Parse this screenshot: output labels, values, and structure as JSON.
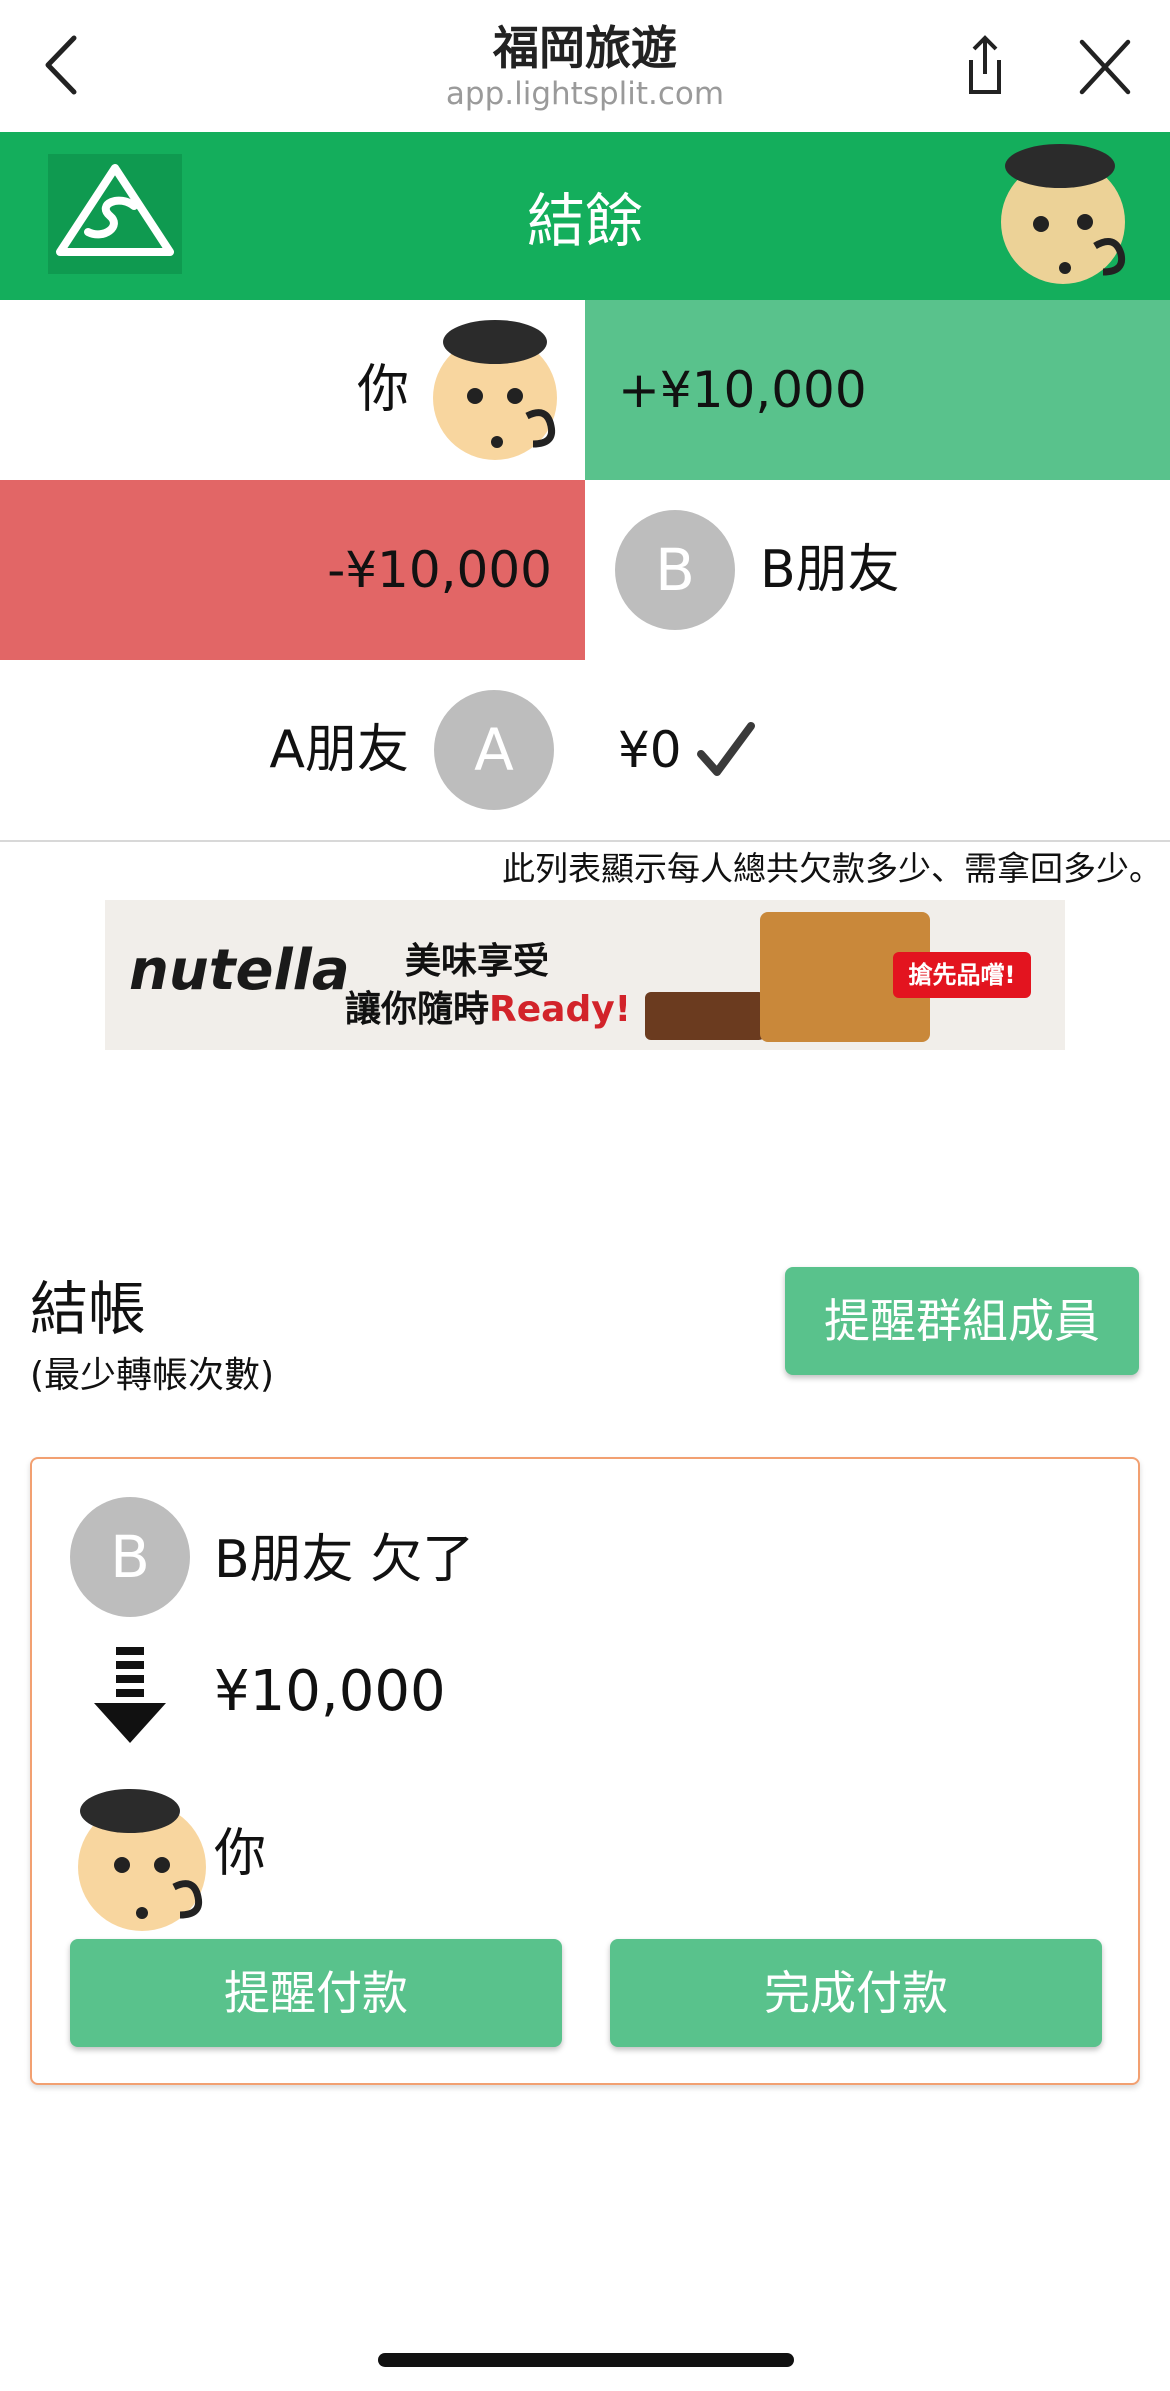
{
  "browser": {
    "title": "福岡旅遊",
    "url": "app.lightsplit.com"
  },
  "header": {
    "title": "結餘"
  },
  "balances": [
    {
      "name": "你",
      "amount": "+¥10,000",
      "status": "positive"
    },
    {
      "name": "B朋友",
      "initial": "B",
      "amount": "-¥10,000",
      "status": "negative"
    },
    {
      "name": "A朋友",
      "initial": "A",
      "amount": "¥0",
      "status": "settled"
    }
  ],
  "balance_note": "此列表顯示每人總共欠款多少、需拿回多少。",
  "ad": {
    "brand_main": "nutella",
    "line1": "美味享受",
    "line2_prefix": "讓你隨時",
    "line2_highlight": "Ready!",
    "cta": "搶先品嚐!"
  },
  "settlement": {
    "title": "結帳",
    "subtitle": "(最少轉帳次數)",
    "remind_all_label": "提醒群組成員",
    "card": {
      "debtor_initial": "B",
      "debtor_text": "B朋友 欠了",
      "amount": "¥10,000",
      "creditor": "你",
      "remind_button": "提醒付款",
      "complete_button": "完成付款"
    }
  },
  "colors": {
    "header_green": "#14ae5c",
    "positive": "#59c28c",
    "negative": "#e26666",
    "avatar_gray": "#bdbdbd",
    "card_border": "#f2a071"
  },
  "icons": [
    "back-chevron-icon",
    "share-icon",
    "close-icon",
    "app-logo-icon",
    "settled-check-icon",
    "down-arrow-icon"
  ]
}
